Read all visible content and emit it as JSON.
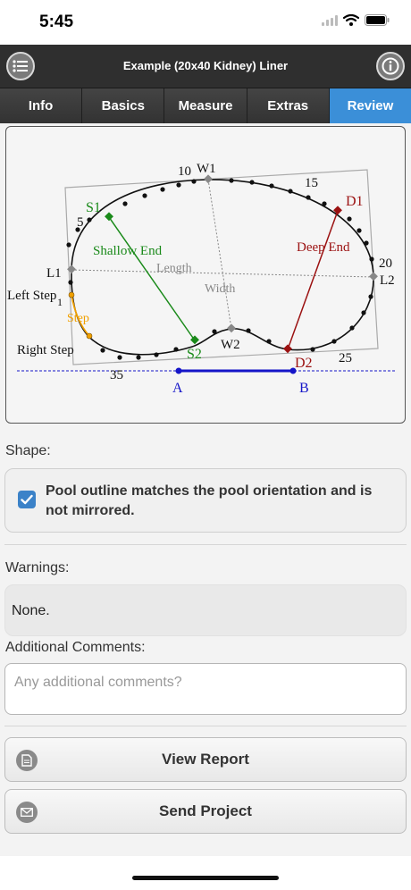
{
  "status_bar": {
    "time": "5:45"
  },
  "header": {
    "title": "Example (20x40 Kidney) Liner",
    "menu_icon": "list-icon",
    "info_icon": "info-icon"
  },
  "tabs": [
    {
      "label": "Info",
      "active": false
    },
    {
      "label": "Basics",
      "active": false
    },
    {
      "label": "Measure",
      "active": false
    },
    {
      "label": "Extras",
      "active": false
    },
    {
      "label": "Review",
      "active": true
    }
  ],
  "diagram": {
    "labels": {
      "w1": "W1",
      "w2": "W2",
      "l1": "L1",
      "l2": "L2",
      "s1": "S1",
      "s2": "S2",
      "d1": "D1",
      "d2": "D2",
      "a": "A",
      "b": "B",
      "shallow_end": "Shallow End",
      "deep_end": "Deep End",
      "length": "Length",
      "width": "Width",
      "left_step": "Left Step",
      "step": "Step",
      "right_step": "Right Step"
    },
    "numbers": {
      "n5": "5",
      "n10": "10",
      "n15": "15",
      "n20": "20",
      "n25": "25",
      "n35": "35",
      "n1": "1"
    },
    "colors": {
      "shallow": "#1a8a1a",
      "deep": "#9b1111",
      "baseline": "#1515c8",
      "step": "#f0a000",
      "guide": "#888888"
    }
  },
  "shape": {
    "label": "Shape:",
    "checked": true,
    "text": "Pool outline matches the pool orientation and is not mirrored."
  },
  "warnings": {
    "label": "Warnings:",
    "text": "None."
  },
  "comments": {
    "label": "Additional Comments:",
    "placeholder": "Any additional comments?"
  },
  "buttons": {
    "view_report": "View Report",
    "send_project": "Send Project"
  },
  "icons": {
    "view_report": "document-icon",
    "send_project": "envelope-icon"
  }
}
